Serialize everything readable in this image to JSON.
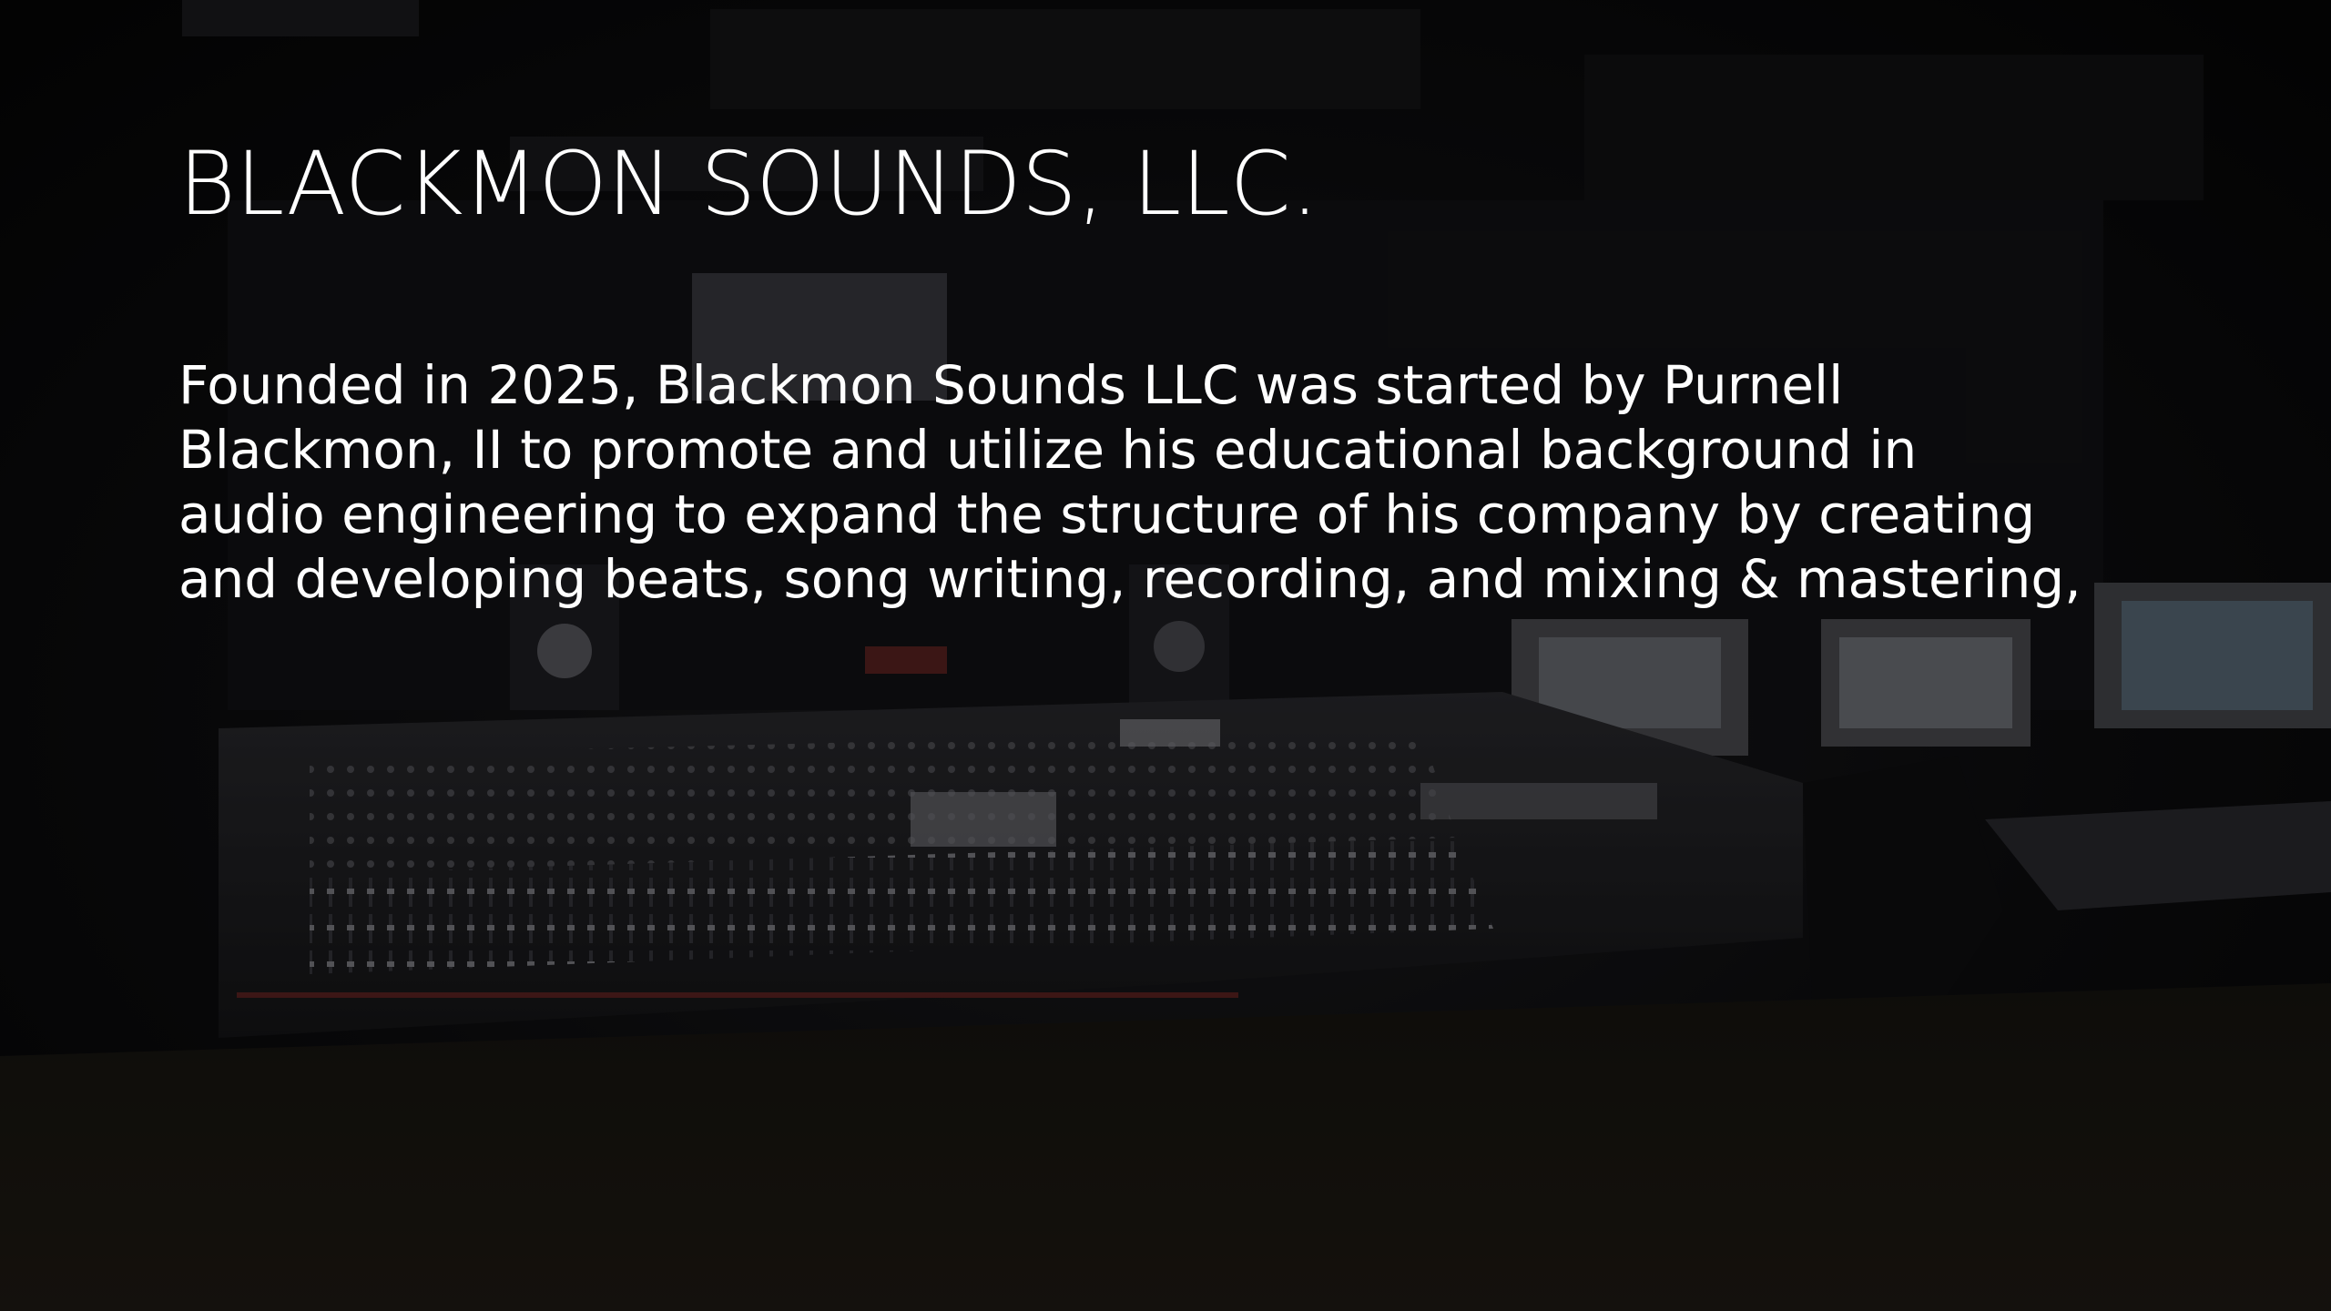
{
  "slide": {
    "title": "BLACKMON SOUNDS, LLC.",
    "body_lines": [
      "Founded in 2025, Blackmon Sounds LLC was started by Purnell",
      "Blackmon, II to promote and utilize his educational background in",
      "audio engineering to expand the structure of his company by creating",
      "and developing beats, song writing, recording, and mixing & mastering,"
    ]
  },
  "background": {
    "description_icon": "recording-studio-photo",
    "accent_color": "#c0392b"
  }
}
